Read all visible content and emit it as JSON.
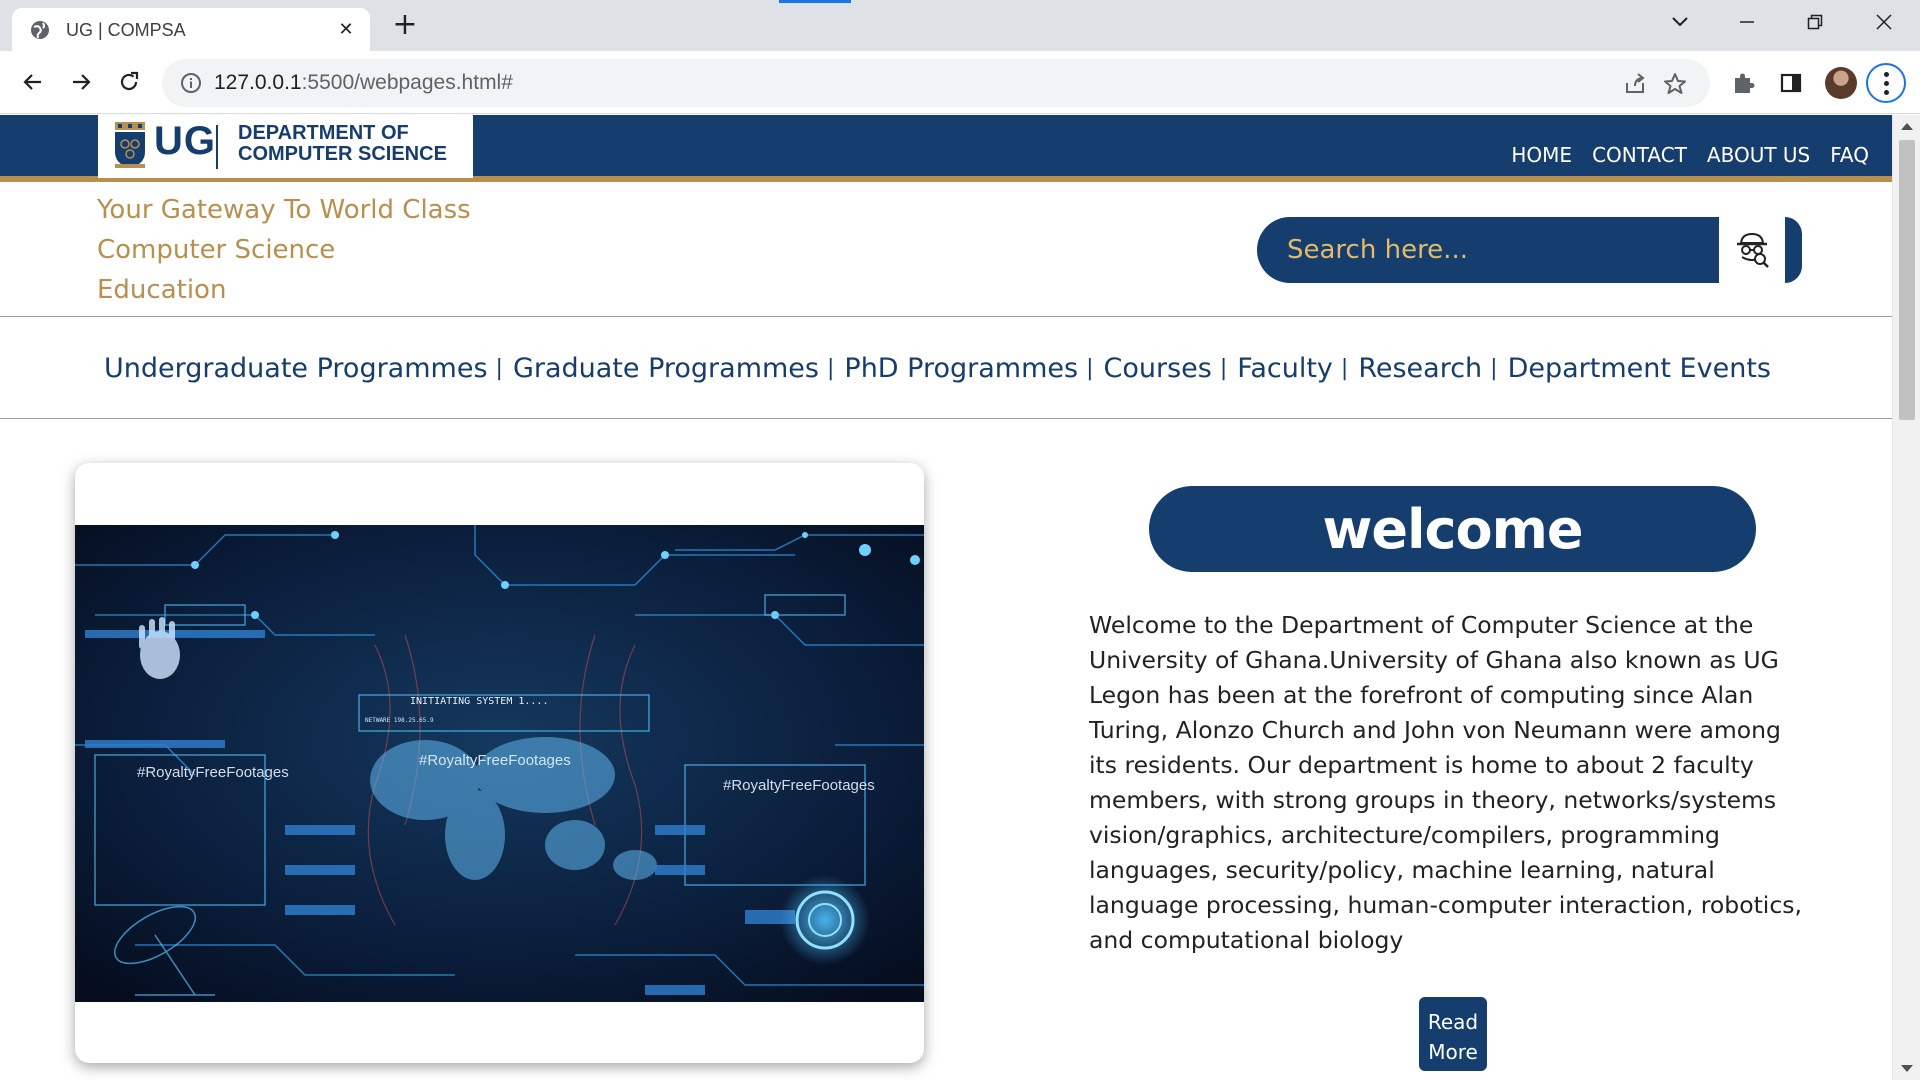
{
  "browser": {
    "tab_title": "UG | COMPSA",
    "url_host": "127.0.0.1",
    "url_path": ":5500/webpages.html#"
  },
  "site": {
    "logo": {
      "ug": "UG",
      "dept_line1": "DEPARTMENT OF",
      "dept_line2": "COMPUTER SCIENCE"
    },
    "top_nav": [
      "HOME",
      "CONTACT",
      "ABOUT US",
      "FAQ"
    ],
    "tagline": [
      "Your Gateway To World Class",
      "Computer Science",
      "Education"
    ],
    "search": {
      "placeholder": "Search here..."
    },
    "sub_nav": [
      "Undergraduate Programmes",
      "Graduate Programmes",
      "PhD Programmes",
      "Courses",
      "Faculty",
      "Research",
      "Department Events"
    ],
    "hero_image": {
      "watermarks": [
        "#RoyaltyFreeFootages",
        "#RoyaltyFreeFootages",
        "#RoyaltyFreeFootages"
      ],
      "hud_text": "INITIATING SYSTEM 1....",
      "hud_subtext": "NETWARE 198.25.65.9"
    },
    "welcome": {
      "title": "welcome",
      "body": "Welcome to the Department of Computer Science at the University of Ghana.University of Ghana also known as UG Legon has been at the forefront of computing since Alan Turing, Alonzo Church and John von Neumann were among its residents. Our department is home to about 2 faculty members, with strong groups in theory, networks/systems vision/graphics, architecture/compilers, programming languages, security/policy, machine learning, natural language processing, human-computer interaction, robotics, and computational biology",
      "read_more_line1": "Read",
      "read_more_line2": "More"
    },
    "colors": {
      "navy": "#153d6e",
      "gold": "#b88f4e",
      "search_text": "#e3b96a"
    }
  }
}
